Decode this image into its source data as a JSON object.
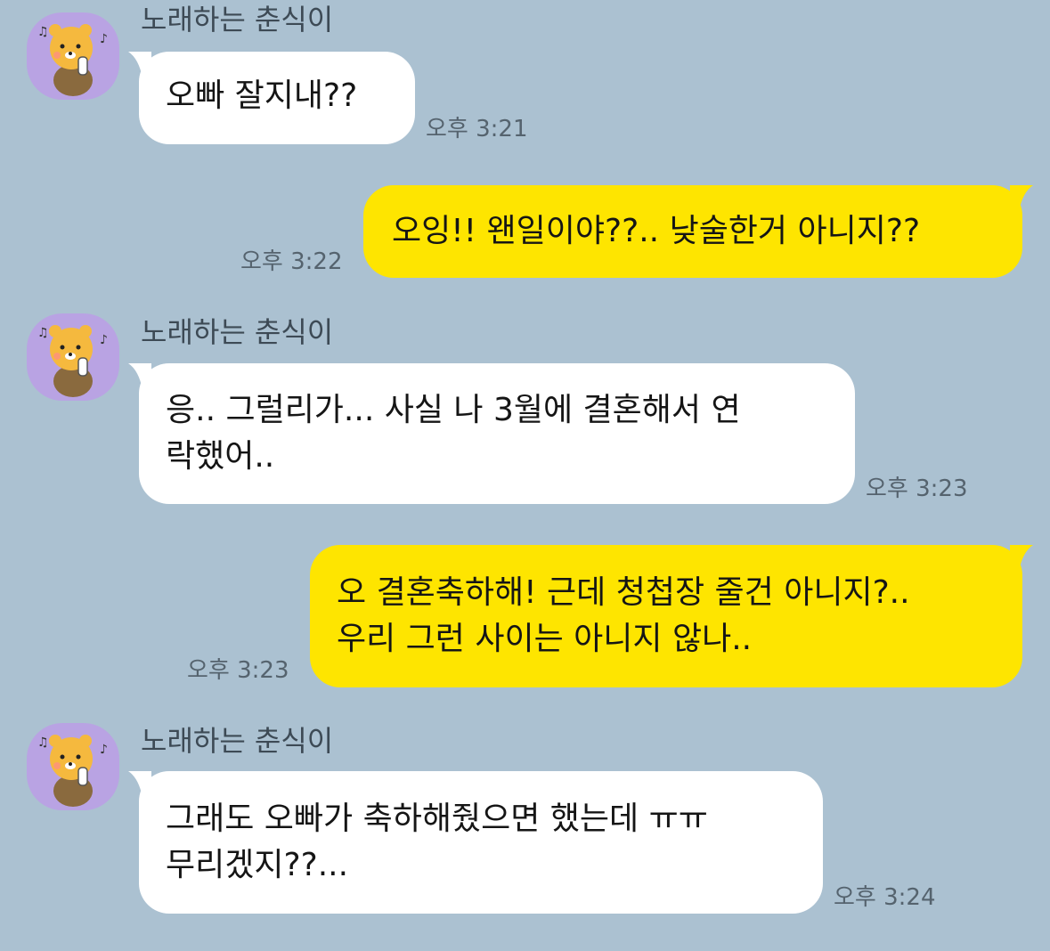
{
  "chat": {
    "sender_name": "노래하는 춘식이",
    "sender_avatar_icon": "singing-choonsik-avatar-icon",
    "colors": {
      "background": "#abc1d1",
      "incoming_bubble": "#ffffff",
      "outgoing_bubble": "#fee500"
    },
    "messages": [
      {
        "direction": "incoming",
        "lines": [
          "오빠 잘지내??"
        ],
        "time": "오후 3:21"
      },
      {
        "direction": "outgoing",
        "lines": [
          "오잉!! 왠일이야??.. 낮술한거 아니지??"
        ],
        "time": "오후 3:22"
      },
      {
        "direction": "incoming",
        "lines": [
          "응.. 그럴리가... 사실 나 3월에 결혼해서 연",
          "락했어.."
        ],
        "time": "오후 3:23"
      },
      {
        "direction": "outgoing",
        "lines": [
          "오 결혼축하해! 근데 청첩장 줄건 아니지?..",
          "우리 그런 사이는 아니지 않나.."
        ],
        "time": "오후 3:23"
      },
      {
        "direction": "incoming",
        "lines": [
          "그래도 오빠가 축하해줬으면 했는데 ㅠㅠ",
          "무리겠지??..."
        ],
        "time": "오후 3:24"
      }
    ]
  }
}
